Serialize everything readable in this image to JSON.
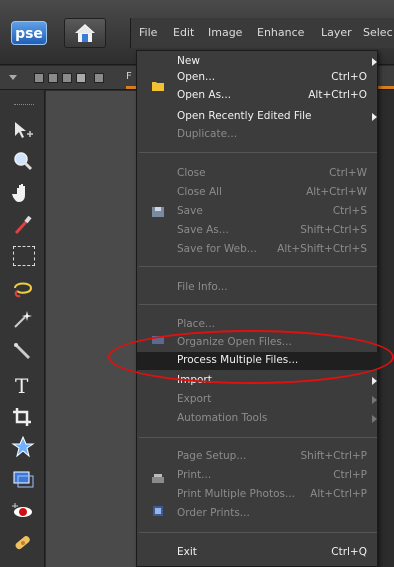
{
  "app": {
    "logo": "pse"
  },
  "menubar": [
    "File",
    "Edit",
    "Image",
    "Enhance",
    "Layer",
    "Selec"
  ],
  "options": {
    "label": "F"
  },
  "icons": {
    "logo": "pse-logo-icon",
    "home": "home-icon",
    "folder": "folder-icon",
    "save": "disk-icon",
    "organize": "organize-icon",
    "print": "printer-icon",
    "order": "order-prints-icon"
  },
  "colors": {
    "accent": "#d77f20",
    "highlight": "#1f1f1f",
    "annotation": "#e01010"
  },
  "menu": {
    "items": [
      {
        "label": "New",
        "shortcut": "",
        "submenu": true,
        "enabled": true
      },
      {
        "label": "Open...",
        "shortcut": "Ctrl+O",
        "submenu": false,
        "enabled": true
      },
      {
        "label": "Open As...",
        "shortcut": "Alt+Ctrl+O",
        "submenu": false,
        "enabled": true
      },
      {
        "label": "Open Recently Edited File",
        "shortcut": "",
        "submenu": true,
        "enabled": true
      },
      {
        "label": "Duplicate...",
        "shortcut": "",
        "submenu": false,
        "enabled": false
      },
      {
        "label": "Close",
        "shortcut": "Ctrl+W",
        "submenu": false,
        "enabled": false
      },
      {
        "label": "Close All",
        "shortcut": "Alt+Ctrl+W",
        "submenu": false,
        "enabled": false
      },
      {
        "label": "Save",
        "shortcut": "Ctrl+S",
        "submenu": false,
        "enabled": false
      },
      {
        "label": "Save As...",
        "shortcut": "Shift+Ctrl+S",
        "submenu": false,
        "enabled": false
      },
      {
        "label": "Save for Web...",
        "shortcut": "Alt+Shift+Ctrl+S",
        "submenu": false,
        "enabled": false
      },
      {
        "label": "File Info...",
        "shortcut": "",
        "submenu": false,
        "enabled": false
      },
      {
        "label": "Place...",
        "shortcut": "",
        "submenu": false,
        "enabled": false
      },
      {
        "label": "Organize Open Files...",
        "shortcut": "",
        "submenu": false,
        "enabled": false
      },
      {
        "label": "Process Multiple Files...",
        "shortcut": "",
        "submenu": false,
        "enabled": true,
        "highlighted": true
      },
      {
        "label": "Import",
        "shortcut": "",
        "submenu": true,
        "enabled": true
      },
      {
        "label": "Export",
        "shortcut": "",
        "submenu": true,
        "enabled": false
      },
      {
        "label": "Automation Tools",
        "shortcut": "",
        "submenu": true,
        "enabled": false
      },
      {
        "label": "Page Setup...",
        "shortcut": "Shift+Ctrl+P",
        "submenu": false,
        "enabled": false
      },
      {
        "label": "Print...",
        "shortcut": "Ctrl+P",
        "submenu": false,
        "enabled": false
      },
      {
        "label": "Print Multiple Photos...",
        "shortcut": "Alt+Ctrl+P",
        "submenu": false,
        "enabled": false
      },
      {
        "label": "Order Prints...",
        "shortcut": "",
        "submenu": false,
        "enabled": false
      },
      {
        "label": "Exit",
        "shortcut": "Ctrl+Q",
        "submenu": false,
        "enabled": true
      }
    ]
  },
  "tools": [
    "move-tool-icon",
    "zoom-tool-icon",
    "hand-tool-icon",
    "eyedropper-tool-icon",
    "marquee-tool-icon",
    "lasso-tool-icon",
    "magic-wand-tool-icon",
    "quick-selection-tool-icon",
    "type-tool-icon",
    "crop-tool-icon",
    "cookie-cutter-tool-icon",
    "straighten-tool-icon",
    "red-eye-tool-icon",
    "spot-healing-tool-icon"
  ]
}
